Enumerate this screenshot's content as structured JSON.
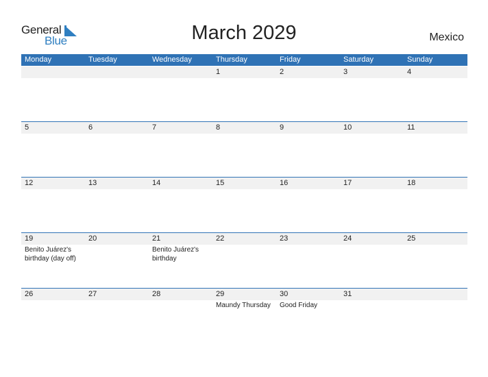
{
  "logo": {
    "part1": "General",
    "part2": "Blue"
  },
  "title": "March 2029",
  "country": "Mexico",
  "colors": {
    "accent": "#2f72b5",
    "logo_blue": "#2f7fc1",
    "date_strip": "#f1f1f1"
  },
  "weekdays": [
    "Monday",
    "Tuesday",
    "Wednesday",
    "Thursday",
    "Friday",
    "Saturday",
    "Sunday"
  ],
  "weeks": [
    {
      "days": [
        {
          "num": "",
          "event": ""
        },
        {
          "num": "",
          "event": ""
        },
        {
          "num": "",
          "event": ""
        },
        {
          "num": "1",
          "event": ""
        },
        {
          "num": "2",
          "event": ""
        },
        {
          "num": "3",
          "event": ""
        },
        {
          "num": "4",
          "event": ""
        }
      ]
    },
    {
      "days": [
        {
          "num": "5",
          "event": ""
        },
        {
          "num": "6",
          "event": ""
        },
        {
          "num": "7",
          "event": ""
        },
        {
          "num": "8",
          "event": ""
        },
        {
          "num": "9",
          "event": ""
        },
        {
          "num": "10",
          "event": ""
        },
        {
          "num": "11",
          "event": ""
        }
      ]
    },
    {
      "days": [
        {
          "num": "12",
          "event": ""
        },
        {
          "num": "13",
          "event": ""
        },
        {
          "num": "14",
          "event": ""
        },
        {
          "num": "15",
          "event": ""
        },
        {
          "num": "16",
          "event": ""
        },
        {
          "num": "17",
          "event": ""
        },
        {
          "num": "18",
          "event": ""
        }
      ]
    },
    {
      "days": [
        {
          "num": "19",
          "event": "Benito Juárez's birthday (day off)"
        },
        {
          "num": "20",
          "event": ""
        },
        {
          "num": "21",
          "event": "Benito Juárez's birthday"
        },
        {
          "num": "22",
          "event": ""
        },
        {
          "num": "23",
          "event": ""
        },
        {
          "num": "24",
          "event": ""
        },
        {
          "num": "25",
          "event": ""
        }
      ]
    },
    {
      "days": [
        {
          "num": "26",
          "event": ""
        },
        {
          "num": "27",
          "event": ""
        },
        {
          "num": "28",
          "event": ""
        },
        {
          "num": "29",
          "event": "Maundy Thursday"
        },
        {
          "num": "30",
          "event": "Good Friday"
        },
        {
          "num": "31",
          "event": ""
        },
        {
          "num": "",
          "event": ""
        }
      ]
    }
  ]
}
